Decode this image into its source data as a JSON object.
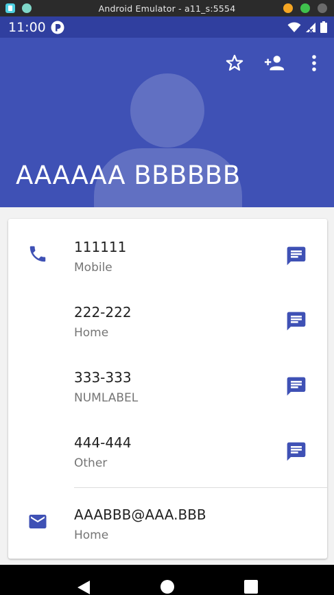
{
  "window": {
    "title": "Android Emulator - a11_s:5554",
    "controls": [
      "minimize-button",
      "maximize-button",
      "close-button"
    ]
  },
  "status_bar": {
    "time": "11:00",
    "icons": [
      "app-notification-icon",
      "wifi-icon",
      "cellular-signal-icon",
      "battery-icon"
    ]
  },
  "header": {
    "contact_name": "AAAAAA BBBBBB",
    "actions": [
      {
        "name": "favorite-star-icon"
      },
      {
        "name": "add-contact-icon"
      },
      {
        "name": "more-options-icon"
      }
    ],
    "color": "#3f51b5"
  },
  "entries": [
    {
      "value": "111111",
      "label": "Mobile",
      "lead_icon": "phone-icon",
      "trail_icon": "message-icon"
    },
    {
      "value": "222-222",
      "label": "Home",
      "lead_icon": "",
      "trail_icon": "message-icon"
    },
    {
      "value": "333-333",
      "label": "NUMLABEL",
      "lead_icon": "",
      "trail_icon": "message-icon"
    },
    {
      "value": "444-444",
      "label": "Other",
      "lead_icon": "",
      "trail_icon": "message-icon"
    },
    {
      "value": "AAABBB@AAA.BBB",
      "label": "Home",
      "lead_icon": "email-icon",
      "trail_icon": ""
    }
  ],
  "nav_bar": {
    "buttons": [
      "back-button",
      "home-button",
      "recents-button"
    ]
  },
  "colors": {
    "accent": "#3f51b5",
    "status_bar": "#303f9f",
    "icon_accent": "#3f51b5"
  }
}
